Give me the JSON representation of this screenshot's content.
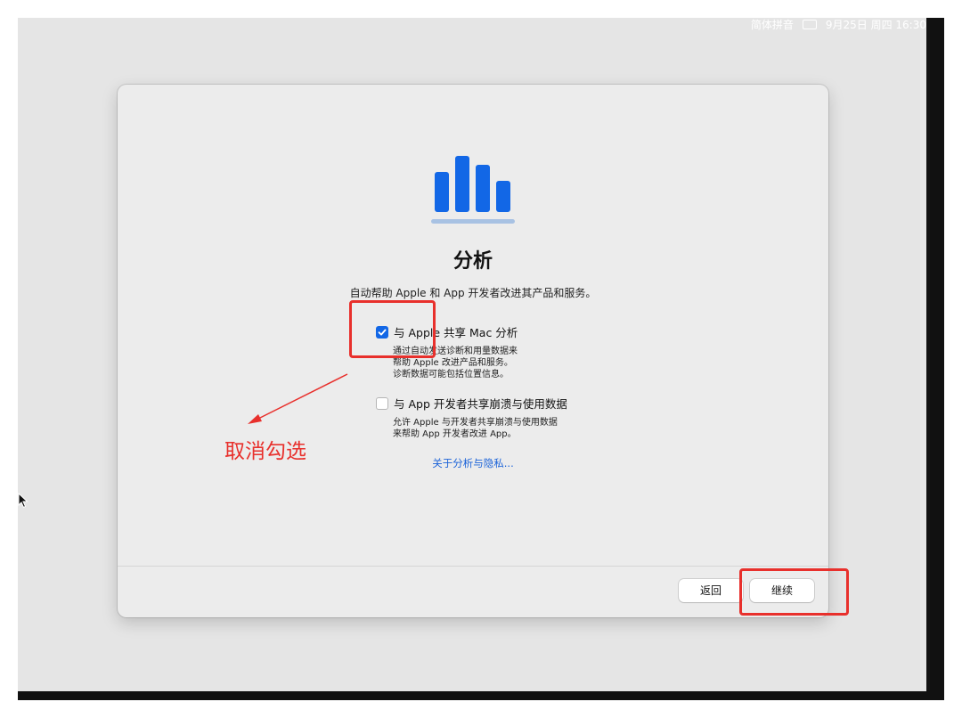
{
  "menubar": {
    "input_method": "简体拼音",
    "keyboard_icon": "keyboard-icon",
    "datetime": "9月25日 周四 16:30"
  },
  "setup": {
    "icon": "analytics-bar-chart-icon",
    "title": "分析",
    "subtitle": "自动帮助 Apple 和 App 开发者改进其产品和服务。",
    "options": [
      {
        "label": "与 Apple 共享 Mac 分析",
        "checked": true,
        "description": [
          "通过自动发送诊断和用量数据来",
          "帮助 Apple 改进产品和服务。",
          "诊断数据可能包括位置信息。"
        ]
      },
      {
        "label": "与 App 开发者共享崩溃与使用数据",
        "checked": false,
        "description": [
          "允许 Apple 与开发者共享崩溃与使用数据",
          "来帮助 App 开发者改进 App。"
        ]
      }
    ],
    "privacy_link": "关于分析与隐私...",
    "back_button": "返回",
    "continue_button": "继续"
  },
  "annotation": {
    "text": "取消勾选",
    "color": "#e8302c"
  },
  "colors": {
    "accent": "#1267e6",
    "link": "#1a62d8"
  }
}
